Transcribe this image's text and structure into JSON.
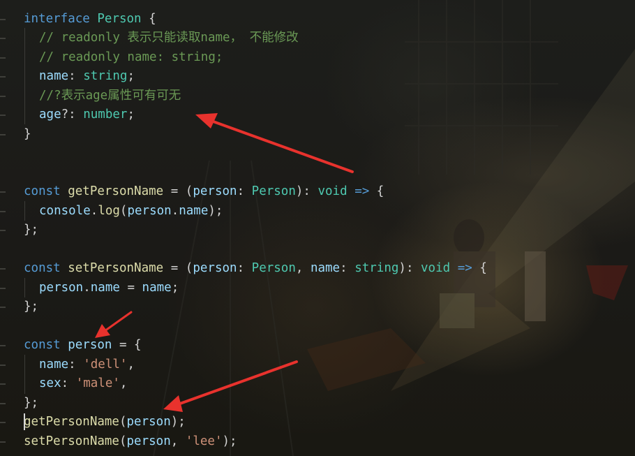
{
  "editor": {
    "accent_arrow_color": "#e8322d",
    "lines": [
      {
        "tokens": [
          {
            "t": "interface",
            "c": "kw"
          },
          {
            "t": " "
          },
          {
            "t": "Person",
            "c": "ty"
          },
          {
            "t": " {"
          }
        ]
      },
      {
        "tokens": [
          {
            "t": "// readonly 表示只能读取name， 不能修改",
            "c": "cm"
          }
        ]
      },
      {
        "tokens": [
          {
            "t": "// readonly name: string;",
            "c": "cm"
          }
        ]
      },
      {
        "tokens": [
          {
            "t": "name",
            "c": "var"
          },
          {
            "t": ": "
          },
          {
            "t": "string",
            "c": "ty"
          },
          {
            "t": ";"
          }
        ]
      },
      {
        "tokens": [
          {
            "t": "//?表示age属性可有可无",
            "c": "cm"
          }
        ]
      },
      {
        "tokens": [
          {
            "t": "age",
            "c": "var"
          },
          {
            "t": "?: "
          },
          {
            "t": "number",
            "c": "ty"
          },
          {
            "t": ";"
          }
        ]
      },
      {
        "tokens": [
          {
            "t": "}"
          }
        ]
      },
      {
        "tokens": [
          {
            "t": "const",
            "c": "kw"
          },
          {
            "t": " "
          },
          {
            "t": "getPersonName",
            "c": "fn"
          },
          {
            "t": " = ("
          },
          {
            "t": "person",
            "c": "var"
          },
          {
            "t": ": "
          },
          {
            "t": "Person",
            "c": "ty"
          },
          {
            "t": "): "
          },
          {
            "t": "void",
            "c": "ty"
          },
          {
            "t": " "
          },
          {
            "t": "=>",
            "c": "kw"
          },
          {
            "t": " {"
          }
        ]
      },
      {
        "tokens": [
          {
            "t": "console",
            "c": "var"
          },
          {
            "t": "."
          },
          {
            "t": "log",
            "c": "fn"
          },
          {
            "t": "("
          },
          {
            "t": "person",
            "c": "var"
          },
          {
            "t": "."
          },
          {
            "t": "name",
            "c": "var"
          },
          {
            "t": ");"
          }
        ]
      },
      {
        "tokens": [
          {
            "t": "};"
          }
        ]
      },
      {
        "tokens": [
          {
            "t": "const",
            "c": "kw"
          },
          {
            "t": " "
          },
          {
            "t": "setPersonName",
            "c": "fn"
          },
          {
            "t": " = ("
          },
          {
            "t": "person",
            "c": "var"
          },
          {
            "t": ": "
          },
          {
            "t": "Person",
            "c": "ty"
          },
          {
            "t": ", "
          },
          {
            "t": "name",
            "c": "var"
          },
          {
            "t": ": "
          },
          {
            "t": "string",
            "c": "ty"
          },
          {
            "t": "): "
          },
          {
            "t": "void",
            "c": "ty"
          },
          {
            "t": " "
          },
          {
            "t": "=>",
            "c": "kw"
          },
          {
            "t": " {"
          }
        ]
      },
      {
        "tokens": [
          {
            "t": "person",
            "c": "var"
          },
          {
            "t": "."
          },
          {
            "t": "name",
            "c": "var"
          },
          {
            "t": " = "
          },
          {
            "t": "name",
            "c": "var"
          },
          {
            "t": ";"
          }
        ]
      },
      {
        "tokens": [
          {
            "t": "};"
          }
        ]
      },
      {
        "tokens": [
          {
            "t": "const",
            "c": "kw"
          },
          {
            "t": " "
          },
          {
            "t": "person",
            "c": "var"
          },
          {
            "t": " = {"
          }
        ]
      },
      {
        "tokens": [
          {
            "t": "name",
            "c": "var"
          },
          {
            "t": ": "
          },
          {
            "t": "'dell'",
            "c": "str"
          },
          {
            "t": ","
          }
        ]
      },
      {
        "tokens": [
          {
            "t": "sex",
            "c": "var"
          },
          {
            "t": ": "
          },
          {
            "t": "'male'",
            "c": "str"
          },
          {
            "t": ","
          }
        ]
      },
      {
        "tokens": [
          {
            "t": "};"
          }
        ]
      },
      {
        "tokens": [
          {
            "t": "getPersonName",
            "c": "fn"
          },
          {
            "t": "("
          },
          {
            "t": "person",
            "c": "var"
          },
          {
            "t": ");"
          }
        ]
      },
      {
        "tokens": [
          {
            "t": "setPersonName",
            "c": "fn"
          },
          {
            "t": "("
          },
          {
            "t": "person",
            "c": "var"
          },
          {
            "t": ", "
          },
          {
            "t": "'lee'",
            "c": "str"
          },
          {
            "t": ");"
          }
        ]
      }
    ]
  }
}
